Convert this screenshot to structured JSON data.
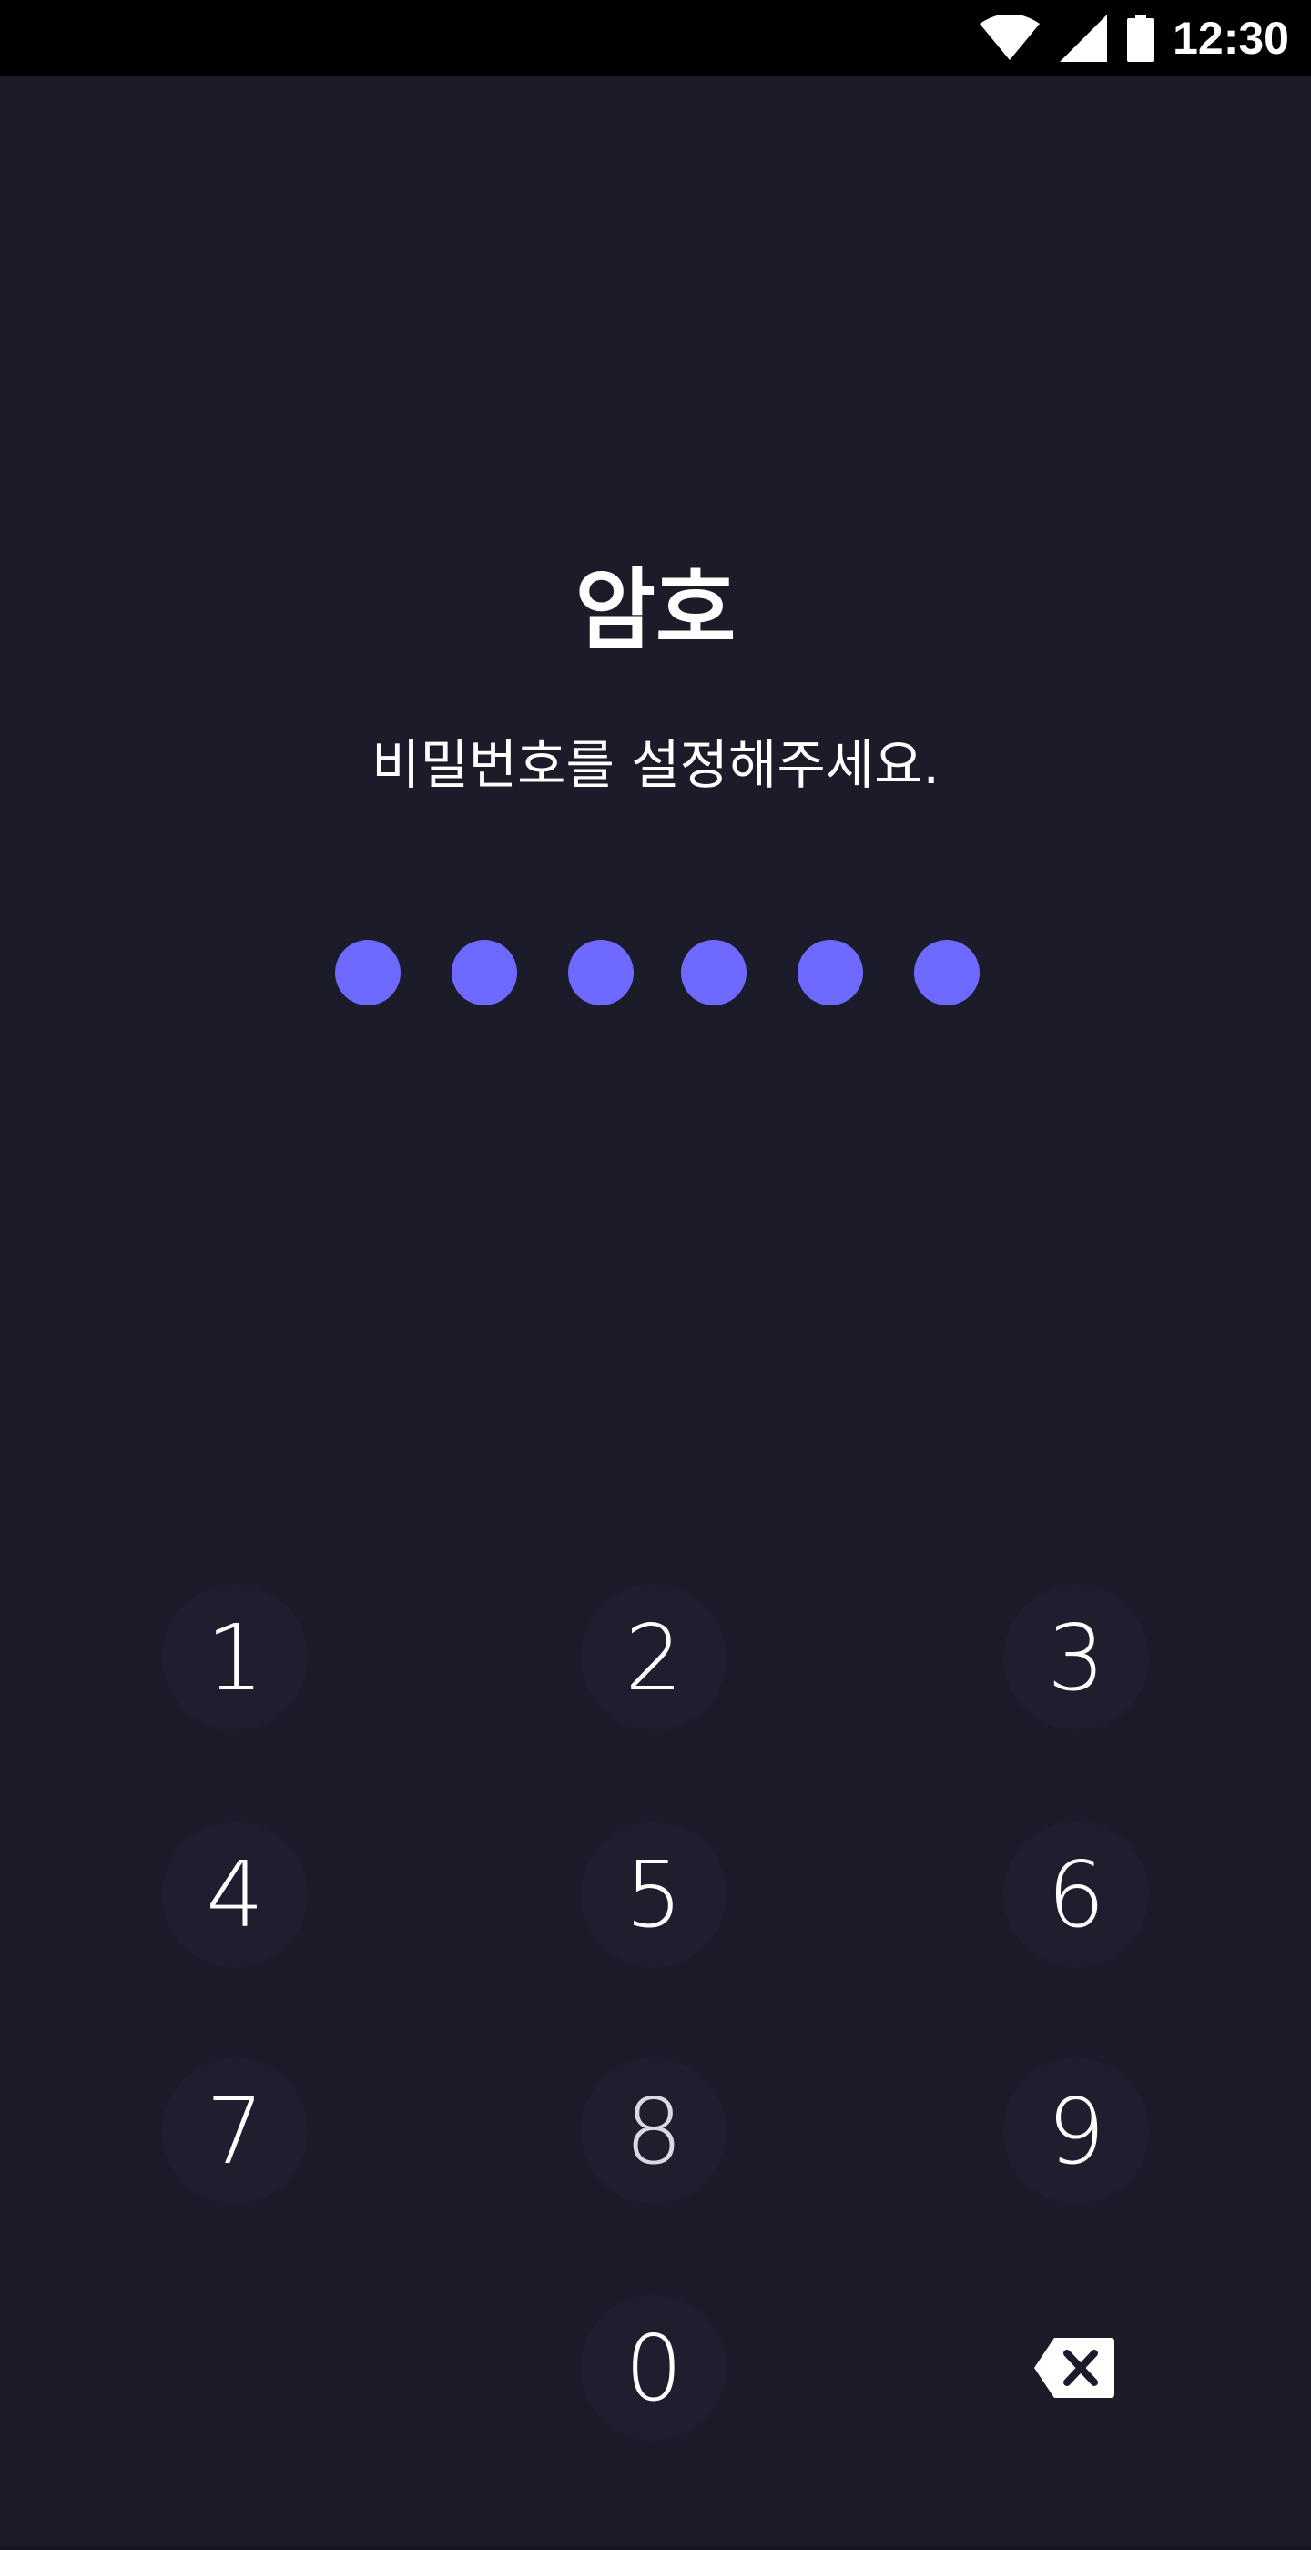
{
  "status_bar": {
    "time": "12:30",
    "icons": [
      "wifi-icon",
      "cell-signal-icon",
      "battery-icon"
    ]
  },
  "header": {
    "title": "암호",
    "subtitle": "비밀번호를 설정해주세요."
  },
  "pin": {
    "length": 6,
    "filled": 6,
    "dot_color": "#6e6aff"
  },
  "keypad": {
    "keys": [
      {
        "label": "1"
      },
      {
        "label": "2"
      },
      {
        "label": "3"
      },
      {
        "label": "4"
      },
      {
        "label": "5"
      },
      {
        "label": "6"
      },
      {
        "label": "7"
      },
      {
        "label": "8"
      },
      {
        "label": "9"
      },
      {
        "label": ""
      },
      {
        "label": "0"
      },
      {
        "label": "",
        "icon": "backspace-icon"
      }
    ]
  },
  "colors": {
    "background": "#1b1b2a",
    "status_bar": "#000000",
    "accent": "#6e6aff",
    "text": "#ffffff"
  }
}
